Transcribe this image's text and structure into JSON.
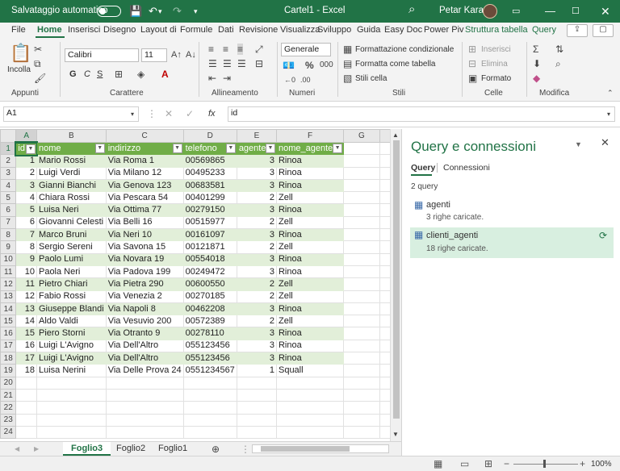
{
  "titlebar": {
    "autosave_label": "Salvataggio automatico",
    "title": "Cartel1  -  Excel",
    "user": "Petar Karan",
    "search_glyph": "⌕"
  },
  "tabs": [
    "File",
    "Home",
    "Inserisci",
    "Disegno",
    "Layout di",
    "Formule",
    "Dati",
    "Revisione",
    "Visualizza",
    "Sviluppo",
    "Guida",
    "Easy Doc",
    "Power Piv",
    "Struttura tabella",
    "Query"
  ],
  "ribbon": {
    "clipboard": {
      "paste": "Incolla",
      "group": "Appunti"
    },
    "font": {
      "name": "Calibri",
      "size": "11",
      "bold": "G",
      "italic": "C",
      "underline": "S",
      "group": "Carattere"
    },
    "alignment": {
      "group": "Allineamento"
    },
    "numbers": {
      "format": "Generale",
      "group": "Numeri"
    },
    "styles": {
      "cond": "Formattazione condizionale",
      "table": "Formatta come tabella",
      "cell": "Stili cella",
      "group": "Stili"
    },
    "cells": {
      "insert": "Inserisci",
      "delete": "Elimina",
      "format": "Formato",
      "group": "Celle"
    },
    "edit": {
      "group": "Modifica"
    }
  },
  "formula_bar": {
    "name_box": "A1",
    "fx": "fx",
    "value": "id"
  },
  "grid": {
    "columns": [
      "A",
      "B",
      "C",
      "D",
      "E",
      "F",
      "G"
    ],
    "headers": [
      "id",
      "nome",
      "indirizzo",
      "telefono",
      "agente",
      "nome_agente"
    ],
    "rows": [
      [
        "1",
        "Mario Rossi",
        "Via Roma 1",
        "00569865",
        "3",
        "Rinoa"
      ],
      [
        "2",
        "Luigi Verdi",
        "Via Milano 12",
        "00495233",
        "3",
        "Rinoa"
      ],
      [
        "3",
        "Gianni Bianchi",
        "Via Genova 123",
        "00683581",
        "3",
        "Rinoa"
      ],
      [
        "4",
        "Chiara Rossi",
        "Via Pescara 54",
        "00401299",
        "2",
        "Zell"
      ],
      [
        "5",
        "Luisa Neri",
        "Via Ottima 77",
        "00279150",
        "3",
        "Rinoa"
      ],
      [
        "6",
        "Giovanni Celesti",
        "Via Belli 16",
        "00515977",
        "2",
        "Zell"
      ],
      [
        "7",
        "Marco Bruni",
        "Via Neri 10",
        "00161097",
        "3",
        "Rinoa"
      ],
      [
        "8",
        "Sergio Sereni",
        "Via Savona 15",
        "00121871",
        "2",
        "Zell"
      ],
      [
        "9",
        "Paolo Lumi",
        "Via Novara 19",
        "00554018",
        "3",
        "Rinoa"
      ],
      [
        "10",
        "Paola Neri",
        "Via Padova 199",
        "00249472",
        "3",
        "Rinoa"
      ],
      [
        "11",
        "Pietro Chiari",
        "Via Pietra 290",
        "00600550",
        "2",
        "Zell"
      ],
      [
        "12",
        "Fabio Rossi",
        "Via Venezia 2",
        "00270185",
        "2",
        "Zell"
      ],
      [
        "13",
        "Giuseppe Blandi",
        "Via Napoli 8",
        "00462208",
        "3",
        "Rinoa"
      ],
      [
        "14",
        "Aldo Valdi",
        "Via Vesuvio 200",
        "00572389",
        "2",
        "Zell"
      ],
      [
        "15",
        "Piero Storni",
        "Via Otranto 9",
        "00278110",
        "3",
        "Rinoa"
      ],
      [
        "16",
        "Luigi L'Avigno",
        "Via Dell'Altro",
        "055123456",
        "3",
        "Rinoa"
      ],
      [
        "17",
        "Luigi L'Avigno",
        "Via Dell'Altro",
        "055123456",
        "3",
        "Rinoa"
      ],
      [
        "18",
        "Luisa Nerini",
        "Via Delle Prova 24",
        "0551234567",
        "1",
        "Squall"
      ]
    ],
    "empty_rows": [
      "20",
      "21",
      "22",
      "23",
      "24"
    ]
  },
  "sheets": [
    "Foglio3",
    "Foglio2",
    "Foglio1"
  ],
  "query_pane": {
    "title": "Query e connessioni",
    "tab_query": "Query",
    "tab_conn": "Connessioni",
    "count": "2 query",
    "items": [
      {
        "name": "agenti",
        "desc": "3 righe caricate."
      },
      {
        "name": "clienti_agenti",
        "desc": "18 righe caricate."
      }
    ]
  },
  "status": {
    "zoom": "100%"
  },
  "colors": {
    "accent": "#217346",
    "table_header": "#70ad47",
    "band": "#e2efd9"
  }
}
